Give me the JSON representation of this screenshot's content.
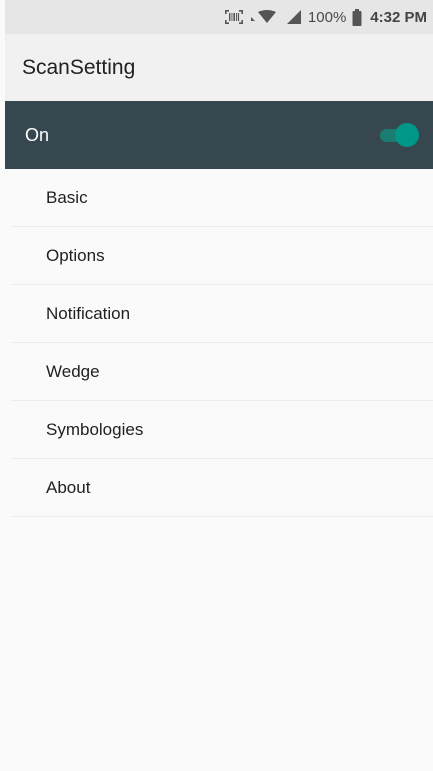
{
  "status_bar": {
    "battery": "100%",
    "time": "4:32 PM"
  },
  "app_bar": {
    "title": "ScanSetting"
  },
  "master_switch": {
    "label": "On",
    "state": "on"
  },
  "menu": {
    "items": [
      {
        "label": "Basic"
      },
      {
        "label": "Options"
      },
      {
        "label": "Notification"
      },
      {
        "label": "Wedge"
      },
      {
        "label": "Symbologies"
      },
      {
        "label": "About"
      }
    ]
  }
}
